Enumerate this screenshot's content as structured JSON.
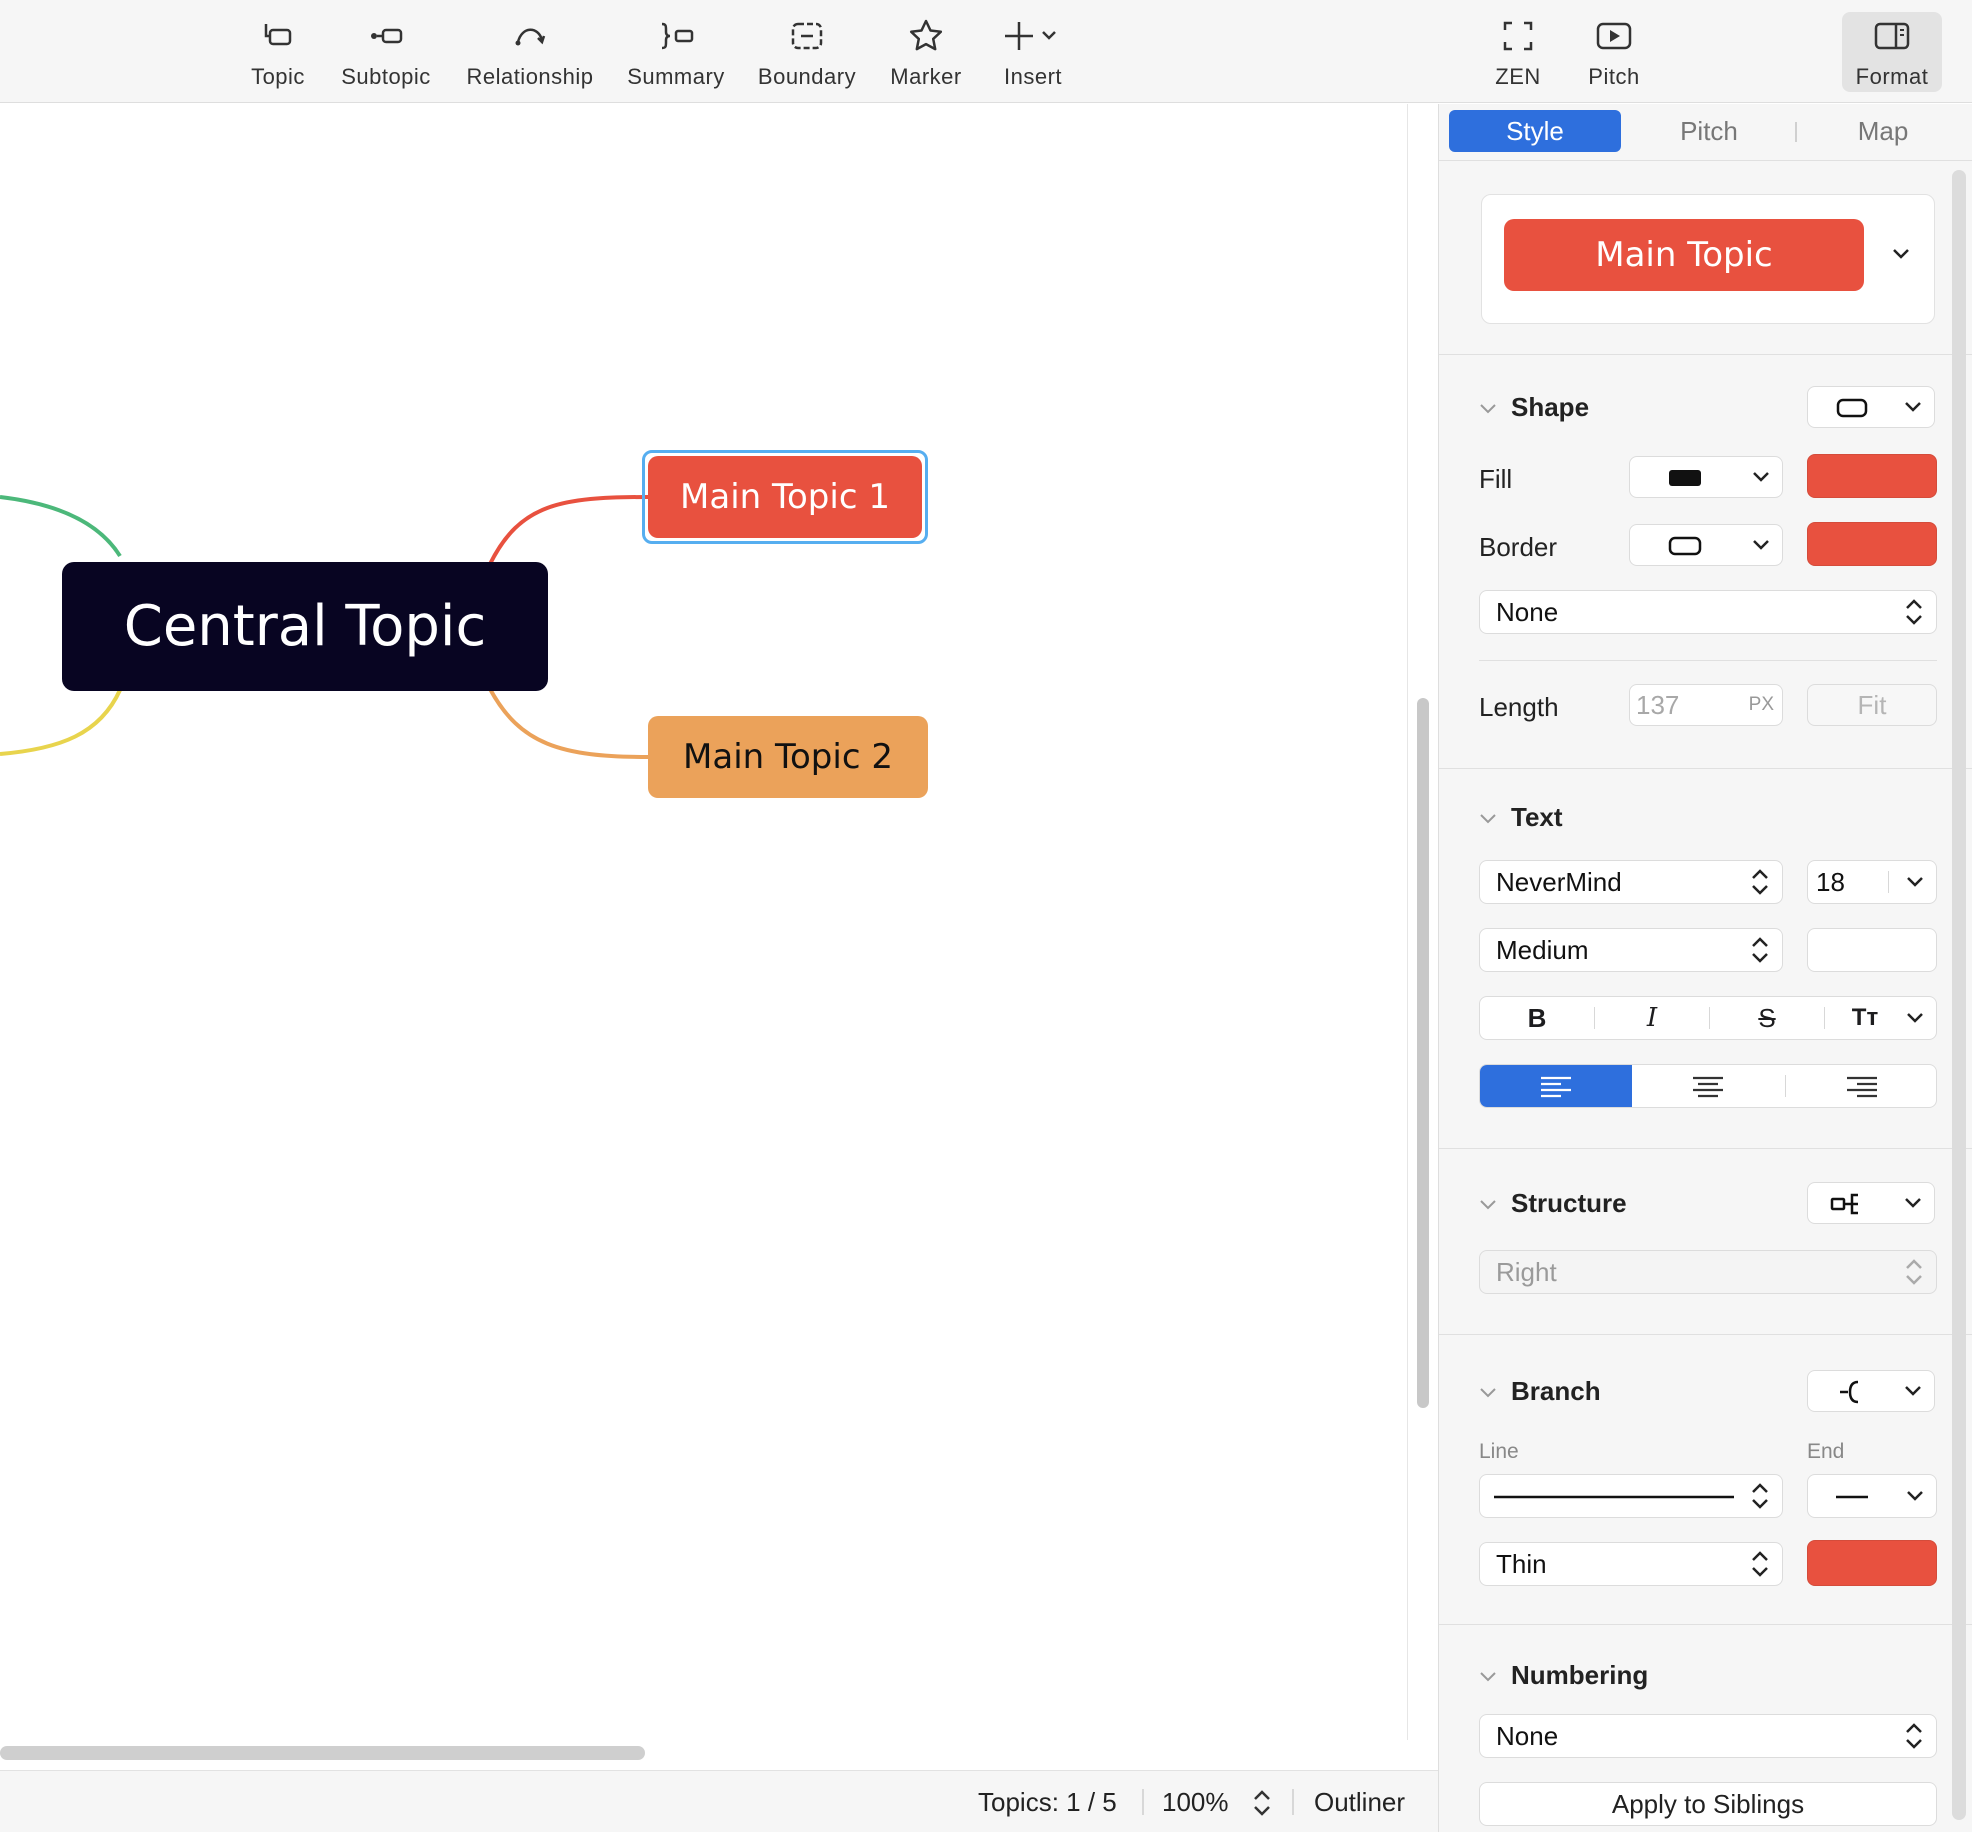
{
  "toolbar": {
    "items": [
      {
        "label": "Topic",
        "icon": "topic-icon"
      },
      {
        "label": "Subtopic",
        "icon": "subtopic-icon"
      },
      {
        "label": "Relationship",
        "icon": "relationship-icon"
      },
      {
        "label": "Summary",
        "icon": "summary-icon"
      },
      {
        "label": "Boundary",
        "icon": "boundary-icon"
      },
      {
        "label": "Marker",
        "icon": "star-icon"
      },
      {
        "label": "Insert",
        "icon": "plus-icon"
      }
    ],
    "zen": "ZEN",
    "pitch": "Pitch",
    "format": "Format"
  },
  "canvas": {
    "central_topic": "Central Topic",
    "main_topic_1": "Main Topic 1",
    "main_topic_2": "Main Topic 2",
    "colors": {
      "central": "#080522",
      "topic1": "#e8513f",
      "topic2": "#eba25a",
      "selection": "#56aef0"
    }
  },
  "status": {
    "topics": "Topics: 1 / 5",
    "zoom": "100%",
    "outliner": "Outliner"
  },
  "sidebar": {
    "tabs": {
      "style": "Style",
      "pitch": "Pitch",
      "map": "Map"
    },
    "preview": "Main Topic",
    "shape": {
      "title": "Shape",
      "fill_label": "Fill",
      "border_label": "Border",
      "border_style": "None",
      "length_label": "Length",
      "length_placeholder": "137",
      "length_unit": "PX",
      "fit": "Fit",
      "fill_color": "#e8513f",
      "border_color": "#e8513f"
    },
    "text": {
      "title": "Text",
      "font": "NeverMind",
      "size": "18",
      "weight": "Medium",
      "bold": "B",
      "italic": "I",
      "strike": "S",
      "case": "Tт"
    },
    "structure": {
      "title": "Structure",
      "direction": "Right"
    },
    "branch": {
      "title": "Branch",
      "line_label": "Line",
      "end_label": "End",
      "thickness": "Thin",
      "color": "#e8513f"
    },
    "numbering": {
      "title": "Numbering",
      "value": "None"
    },
    "apply": "Apply to Siblings",
    "accent": "#2e6fdd"
  }
}
